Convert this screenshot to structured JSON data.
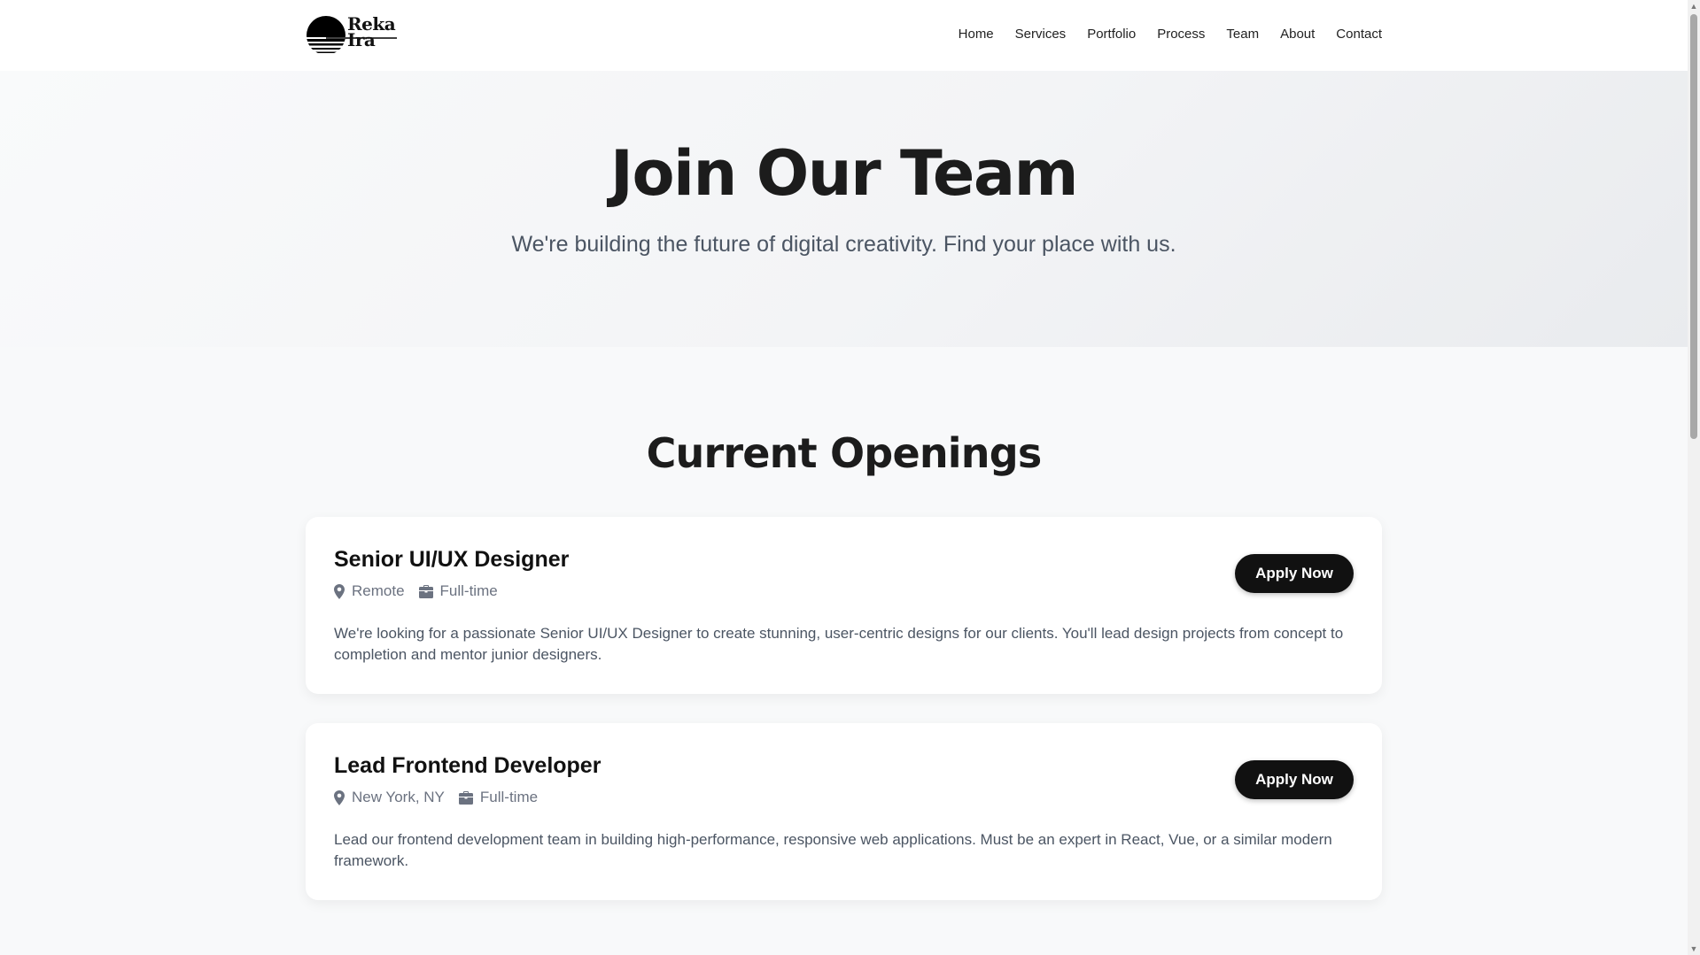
{
  "brand": {
    "logo_line1": "Reka",
    "logo_line2": "Ira"
  },
  "nav": {
    "items": [
      "Home",
      "Services",
      "Portfolio",
      "Process",
      "Team",
      "About",
      "Contact"
    ]
  },
  "hero": {
    "title": "Join Our Team",
    "subtitle": "We're building the future of digital creativity. Find your place with us."
  },
  "openings": {
    "title": "Current Openings",
    "jobs": [
      {
        "title": "Senior UI/UX Designer",
        "location": "Remote",
        "type": "Full-time",
        "description": "We're looking for a passionate Senior UI/UX Designer to create stunning, user-centric designs for our clients. You'll lead design projects from concept to completion and mentor junior designers.",
        "apply_label": "Apply Now"
      },
      {
        "title": "Lead Frontend Developer",
        "location": "New York, NY",
        "type": "Full-time",
        "description": "Lead our frontend development team in building high-performance, responsive web applications. Must be an expert in React, Vue, or a similar modern framework.",
        "apply_label": "Apply Now"
      }
    ]
  },
  "icons": {
    "location": "map-pin-icon",
    "job_type": "briefcase-icon",
    "scroll_up": "arrow-up-icon",
    "scroll_down": "arrow-down-icon"
  },
  "colors": {
    "button_bg": "#111111",
    "hero_title": "#1c1c1c",
    "muted_text": "#6b7280"
  }
}
